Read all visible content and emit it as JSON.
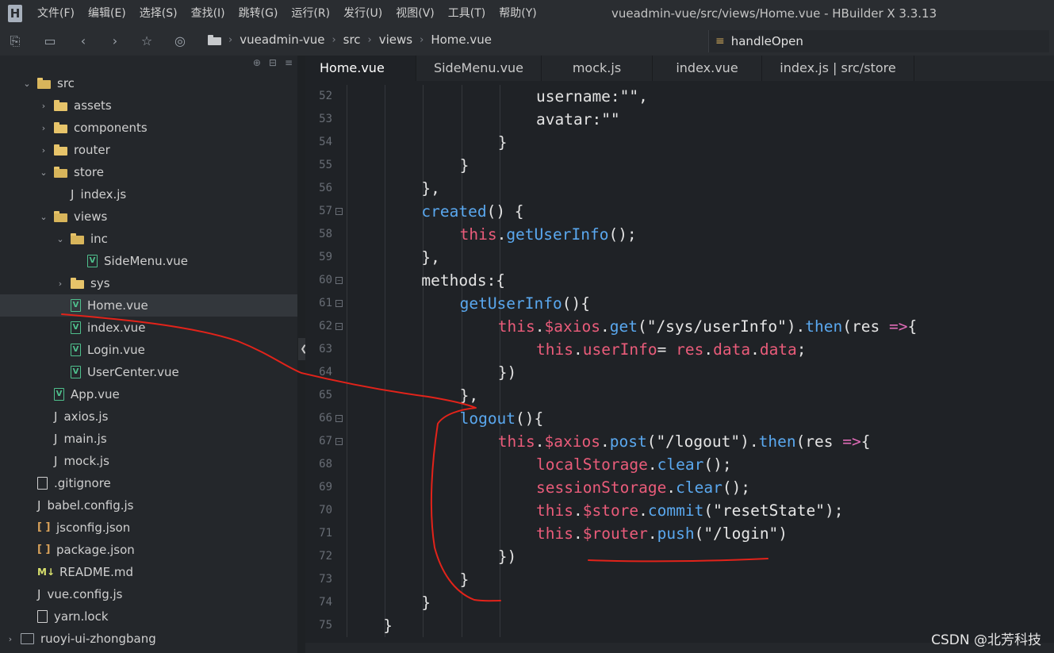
{
  "app": {
    "logo_letter": "H",
    "window_title": "vueadmin-vue/src/views/Home.vue - HBuilder X 3.3.13",
    "menu": [
      "文件(F)",
      "编辑(E)",
      "选择(S)",
      "查找(I)",
      "跳转(G)",
      "运行(R)",
      "发行(U)",
      "视图(V)",
      "工具(T)",
      "帮助(Y)"
    ]
  },
  "toolbar": {
    "icons": [
      "save-as-icon",
      "save-icon",
      "back-arrow-icon",
      "forward-arrow-icon",
      "bookmark-star-icon",
      "run-icon"
    ],
    "breadcrumb": [
      "vueadmin-vue",
      "src",
      "views",
      "Home.vue"
    ],
    "symbol_search": "handleOpen"
  },
  "sidebar": {
    "items": [
      {
        "label": "src",
        "kind": "folder",
        "depth": 0,
        "expanded": true
      },
      {
        "label": "assets",
        "kind": "folder",
        "depth": 1,
        "expanded": false
      },
      {
        "label": "components",
        "kind": "folder",
        "depth": 1,
        "expanded": false
      },
      {
        "label": "router",
        "kind": "folder",
        "depth": 1,
        "expanded": false
      },
      {
        "label": "store",
        "kind": "folder",
        "depth": 1,
        "expanded": true
      },
      {
        "label": "index.js",
        "kind": "js",
        "depth": 2
      },
      {
        "label": "views",
        "kind": "folder",
        "depth": 1,
        "expanded": true
      },
      {
        "label": "inc",
        "kind": "folder",
        "depth": 2,
        "expanded": true
      },
      {
        "label": "SideMenu.vue",
        "kind": "vue",
        "depth": 3
      },
      {
        "label": "sys",
        "kind": "folder",
        "depth": 2,
        "expanded": false
      },
      {
        "label": "Home.vue",
        "kind": "vue",
        "depth": 2,
        "selected": true
      },
      {
        "label": "index.vue",
        "kind": "vue",
        "depth": 2
      },
      {
        "label": "Login.vue",
        "kind": "vue",
        "depth": 2
      },
      {
        "label": "UserCenter.vue",
        "kind": "vue",
        "depth": 2
      },
      {
        "label": "App.vue",
        "kind": "vue",
        "depth": 1
      },
      {
        "label": "axios.js",
        "kind": "js",
        "depth": 1
      },
      {
        "label": "main.js",
        "kind": "js",
        "depth": 1
      },
      {
        "label": "mock.js",
        "kind": "js",
        "depth": 1
      },
      {
        "label": ".gitignore",
        "kind": "plain",
        "depth": 0
      },
      {
        "label": "babel.config.js",
        "kind": "js",
        "depth": 0
      },
      {
        "label": "jsconfig.json",
        "kind": "json",
        "depth": 0
      },
      {
        "label": "package.json",
        "kind": "json",
        "depth": 0
      },
      {
        "label": "README.md",
        "kind": "md",
        "depth": 0
      },
      {
        "label": "vue.config.js",
        "kind": "js",
        "depth": 0
      },
      {
        "label": "yarn.lock",
        "kind": "plain",
        "depth": 0
      },
      {
        "label": "ruoyi-ui-zhongbang",
        "kind": "lib",
        "depth": -1,
        "expanded": false
      }
    ]
  },
  "editor": {
    "tabs": [
      {
        "label": "Home.vue",
        "active": true
      },
      {
        "label": "SideMenu.vue"
      },
      {
        "label": "mock.js"
      },
      {
        "label": "index.vue"
      },
      {
        "label": "index.js | src/store"
      }
    ],
    "lines": [
      {
        "n": "52",
        "fold": false,
        "indent": 6,
        "tokens": [
          [
            "username:",
            "t-white"
          ],
          [
            "\"\"",
            "t-str"
          ],
          [
            ",",
            "t-white"
          ]
        ]
      },
      {
        "n": "53",
        "fold": false,
        "indent": 6,
        "tokens": [
          [
            "avatar:",
            "t-white"
          ],
          [
            "\"\"",
            "t-str"
          ]
        ]
      },
      {
        "n": "54",
        "fold": false,
        "indent": 5,
        "tokens": [
          [
            "}",
            "t-white"
          ]
        ]
      },
      {
        "n": "55",
        "fold": false,
        "indent": 4,
        "tokens": [
          [
            "}",
            "t-white"
          ]
        ]
      },
      {
        "n": "56",
        "fold": false,
        "indent": 3,
        "tokens": [
          [
            "},",
            "t-white"
          ]
        ]
      },
      {
        "n": "57",
        "fold": true,
        "indent": 3,
        "tokens": [
          [
            "created",
            "t-fn"
          ],
          [
            "() {",
            "t-white"
          ]
        ]
      },
      {
        "n": "58",
        "fold": false,
        "indent": 4,
        "tokens": [
          [
            "this",
            "t-kw"
          ],
          [
            ".",
            "t-white"
          ],
          [
            "getUserInfo",
            "t-fn"
          ],
          [
            "();",
            "t-white"
          ]
        ]
      },
      {
        "n": "59",
        "fold": false,
        "indent": 3,
        "tokens": [
          [
            "},",
            "t-white"
          ]
        ]
      },
      {
        "n": "60",
        "fold": true,
        "indent": 3,
        "tokens": [
          [
            "methods:{",
            "t-white"
          ]
        ]
      },
      {
        "n": "61",
        "fold": true,
        "indent": 4,
        "tokens": [
          [
            "getUserInfo",
            "t-fn"
          ],
          [
            "(){",
            "t-white"
          ]
        ]
      },
      {
        "n": "62",
        "fold": true,
        "indent": 5,
        "tokens": [
          [
            "this",
            "t-kw"
          ],
          [
            ".",
            "t-white"
          ],
          [
            "$axios",
            "t-kw"
          ],
          [
            ".",
            "t-white"
          ],
          [
            "get",
            "t-fn"
          ],
          [
            "(",
            "t-white"
          ],
          [
            "\"/sys/userInfo\"",
            "t-str"
          ],
          [
            ").",
            "t-white"
          ],
          [
            "then",
            "t-fn"
          ],
          [
            "(res ",
            "t-white"
          ],
          [
            "=>",
            "t-op"
          ],
          [
            "{",
            "t-white"
          ]
        ]
      },
      {
        "n": "63",
        "fold": false,
        "indent": 6,
        "tokens": [
          [
            "this",
            "t-kw"
          ],
          [
            ".",
            "t-white"
          ],
          [
            "userInfo",
            "t-kw"
          ],
          [
            "= ",
            "t-white"
          ],
          [
            "res",
            "t-kw"
          ],
          [
            ".",
            "t-white"
          ],
          [
            "data",
            "t-kw"
          ],
          [
            ".",
            "t-white"
          ],
          [
            "data",
            "t-kw"
          ],
          [
            ";",
            "t-white"
          ]
        ]
      },
      {
        "n": "64",
        "fold": false,
        "indent": 5,
        "tokens": [
          [
            "})",
            "t-white"
          ]
        ]
      },
      {
        "n": "65",
        "fold": false,
        "indent": 4,
        "tokens": [
          [
            "},",
            "t-white"
          ]
        ]
      },
      {
        "n": "66",
        "fold": true,
        "indent": 4,
        "tokens": [
          [
            "logout",
            "t-fn"
          ],
          [
            "(){",
            "t-white"
          ]
        ]
      },
      {
        "n": "67",
        "fold": true,
        "indent": 5,
        "tokens": [
          [
            "this",
            "t-kw"
          ],
          [
            ".",
            "t-white"
          ],
          [
            "$axios",
            "t-kw"
          ],
          [
            ".",
            "t-white"
          ],
          [
            "post",
            "t-fn"
          ],
          [
            "(",
            "t-white"
          ],
          [
            "\"/logout\"",
            "t-str"
          ],
          [
            ").",
            "t-white"
          ],
          [
            "then",
            "t-fn"
          ],
          [
            "(res ",
            "t-white"
          ],
          [
            "=>",
            "t-op"
          ],
          [
            "{",
            "t-white"
          ]
        ]
      },
      {
        "n": "68",
        "fold": false,
        "indent": 6,
        "tokens": [
          [
            "localStorage",
            "t-kw"
          ],
          [
            ".",
            "t-white"
          ],
          [
            "clear",
            "t-fn"
          ],
          [
            "();",
            "t-white"
          ]
        ]
      },
      {
        "n": "69",
        "fold": false,
        "indent": 6,
        "tokens": [
          [
            "sessionStorage",
            "t-kw"
          ],
          [
            ".",
            "t-white"
          ],
          [
            "clear",
            "t-fn"
          ],
          [
            "();",
            "t-white"
          ]
        ]
      },
      {
        "n": "70",
        "fold": false,
        "indent": 6,
        "tokens": [
          [
            "this",
            "t-kw"
          ],
          [
            ".",
            "t-white"
          ],
          [
            "$store",
            "t-kw"
          ],
          [
            ".",
            "t-white"
          ],
          [
            "commit",
            "t-fn"
          ],
          [
            "(",
            "t-white"
          ],
          [
            "\"resetState\"",
            "t-str"
          ],
          [
            ");",
            "t-white"
          ]
        ]
      },
      {
        "n": "71",
        "fold": false,
        "indent": 6,
        "tokens": [
          [
            "this",
            "t-kw"
          ],
          [
            ".",
            "t-white"
          ],
          [
            "$router",
            "t-kw"
          ],
          [
            ".",
            "t-white"
          ],
          [
            "push",
            "t-fn"
          ],
          [
            "(",
            "t-white"
          ],
          [
            "\"/login\"",
            "t-str"
          ],
          [
            ")",
            "t-white"
          ]
        ]
      },
      {
        "n": "72",
        "fold": false,
        "indent": 5,
        "tokens": [
          [
            "})",
            "t-white"
          ]
        ]
      },
      {
        "n": "73",
        "fold": false,
        "indent": 4,
        "tokens": [
          [
            "}",
            "t-white"
          ]
        ]
      },
      {
        "n": "74",
        "fold": false,
        "indent": 3,
        "tokens": [
          [
            "}",
            "t-white"
          ]
        ]
      },
      {
        "n": "75",
        "fold": false,
        "indent": 2,
        "tokens": [
          [
            "}",
            "t-white"
          ]
        ]
      }
    ]
  },
  "watermark": "CSDN @北芳科技",
  "colors": {
    "accent_red": "#e2231a",
    "vue_green": "#4fc08d",
    "folder": "#e7c46a"
  }
}
